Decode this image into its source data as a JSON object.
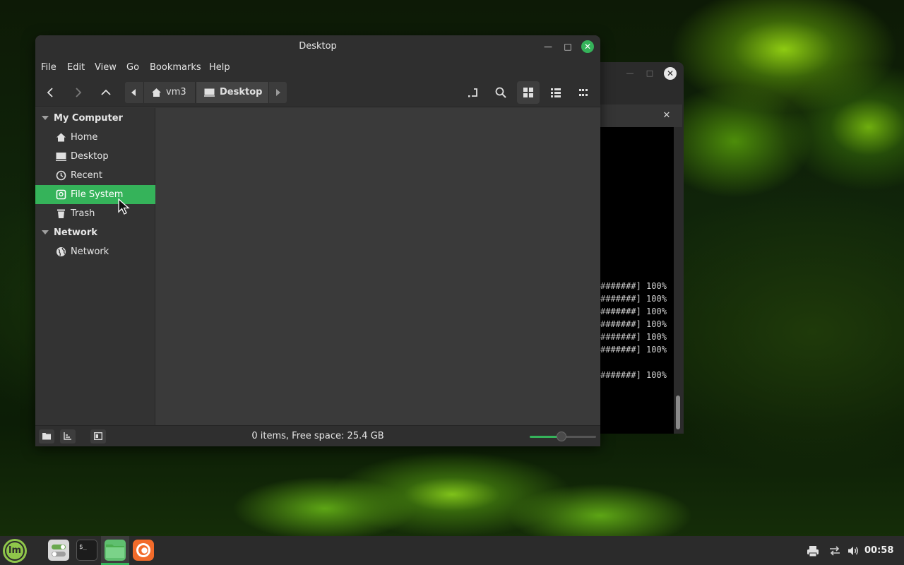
{
  "desktop": {
    "theme": {
      "accent": "#35b35a",
      "window_bg": "#3a3a3a",
      "header_bg": "#2f2f2f"
    }
  },
  "terminal": {
    "lines": [
      "#######] 100%",
      "#######] 100%",
      "#######] 100%",
      "#######] 100%",
      "#######] 100%",
      "#######] 100%",
      "#######] 100%"
    ],
    "close_glyph": "✕",
    "tab_close_glyph": "✕",
    "minimize_glyph": "—",
    "maximize_glyph": "□"
  },
  "file_manager": {
    "title": "Desktop",
    "window_controls": {
      "minimize": "—",
      "maximize": "□",
      "close": "✕"
    },
    "menu": [
      "File",
      "Edit",
      "View",
      "Go",
      "Bookmarks",
      "Help"
    ],
    "toolbar": {
      "back_icon": "chevron-left-icon",
      "forward_icon": "chevron-right-icon",
      "up_icon": "chevron-up-icon",
      "breadcrumbs": [
        "vm3",
        "Desktop"
      ],
      "right_tools": [
        "toggle-location-icon",
        "search-icon",
        "icon-view-icon",
        "list-view-icon",
        "compact-view-icon"
      ],
      "active_view": "icon-view"
    },
    "sidebar": {
      "sections": [
        {
          "title": "My Computer",
          "items": [
            {
              "label": "Home",
              "icon": "home-icon"
            },
            {
              "label": "Desktop",
              "icon": "desktop-icon"
            },
            {
              "label": "Recent",
              "icon": "recent-clock-icon"
            },
            {
              "label": "File System",
              "icon": "drive-icon",
              "selected": true
            },
            {
              "label": "Trash",
              "icon": "trash-icon"
            }
          ]
        },
        {
          "title": "Network",
          "items": [
            {
              "label": "Network",
              "icon": "globe-icon"
            }
          ]
        }
      ]
    },
    "status": {
      "text": "0 items, Free space: 25.4 GB",
      "zoom_level_fraction": 0.48
    }
  },
  "taskbar": {
    "menu_label": "lm",
    "launchers": [
      "settings-app",
      "terminal-app",
      "files-app",
      "firefox-app"
    ],
    "active_launcher": "files-app",
    "tray": [
      "printer-icon",
      "network-icon",
      "volume-icon"
    ],
    "clock": "00:58"
  }
}
